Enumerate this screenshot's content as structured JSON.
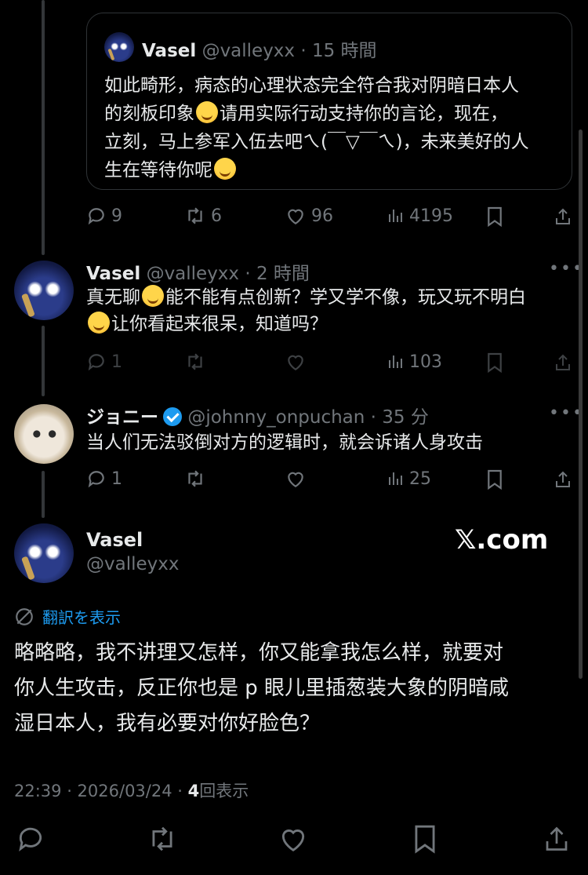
{
  "quoted": {
    "name": "Vasel",
    "handle": "@valleyxx",
    "time": "· 15 時間",
    "lines": [
      "如此畸形，病态的心理状态完全符合我对阴暗日本人",
      "的刻板印象",
      "请用实际行动支持你的言论，现在，",
      "立刻，马上参军入伍去吧ㄟ(￣▽￣ㄟ)，未来美好的人",
      "生在等待你呢"
    ],
    "stats": {
      "replies": "9",
      "reposts": "6",
      "likes": "96",
      "views": "4195"
    }
  },
  "reply1": {
    "name": "Vasel",
    "handle": "@valleyxx",
    "time": "· 2 時間",
    "line1a": "真无聊",
    "line1b": "能不能有点创新？学又学不像，玩又玩不明白",
    "line2": "让你看起来很呆，知道吗？",
    "stats": {
      "replies": "1",
      "views": "103"
    }
  },
  "reply2": {
    "name": "ジョニー",
    "handle": "@johnny_onpuchan",
    "time": "· 35 分",
    "text": "当人们无法驳倒对方的逻辑时，就会诉诸人身攻击",
    "stats": {
      "replies": "1",
      "views": "25"
    }
  },
  "main": {
    "name": "Vasel",
    "handle": "@valleyxx",
    "watermark": "𝕏.com",
    "translate": "翻訳を表示",
    "lines": [
      "略略略，我不讲理又怎样，你又能拿我怎么样，就要对",
      "你人生攻击，反正你也是 p 眼儿里插葱装大象的阴暗咸",
      "湿日本人，我有必要对你好脸色？"
    ],
    "timestamp": "22:39 · 2026/03/24 · ",
    "views_count": "4",
    "views_label": "回表示"
  },
  "icons": [
    "reply-icon",
    "repost-icon",
    "like-icon",
    "views-icon",
    "bookmark-icon",
    "share-icon",
    "more-icon",
    "translate-icon",
    "verified-badge"
  ],
  "colors": {
    "background": "#000000",
    "text": "#e7e9ea",
    "muted": "#71767b",
    "link": "#1d9bf0"
  }
}
